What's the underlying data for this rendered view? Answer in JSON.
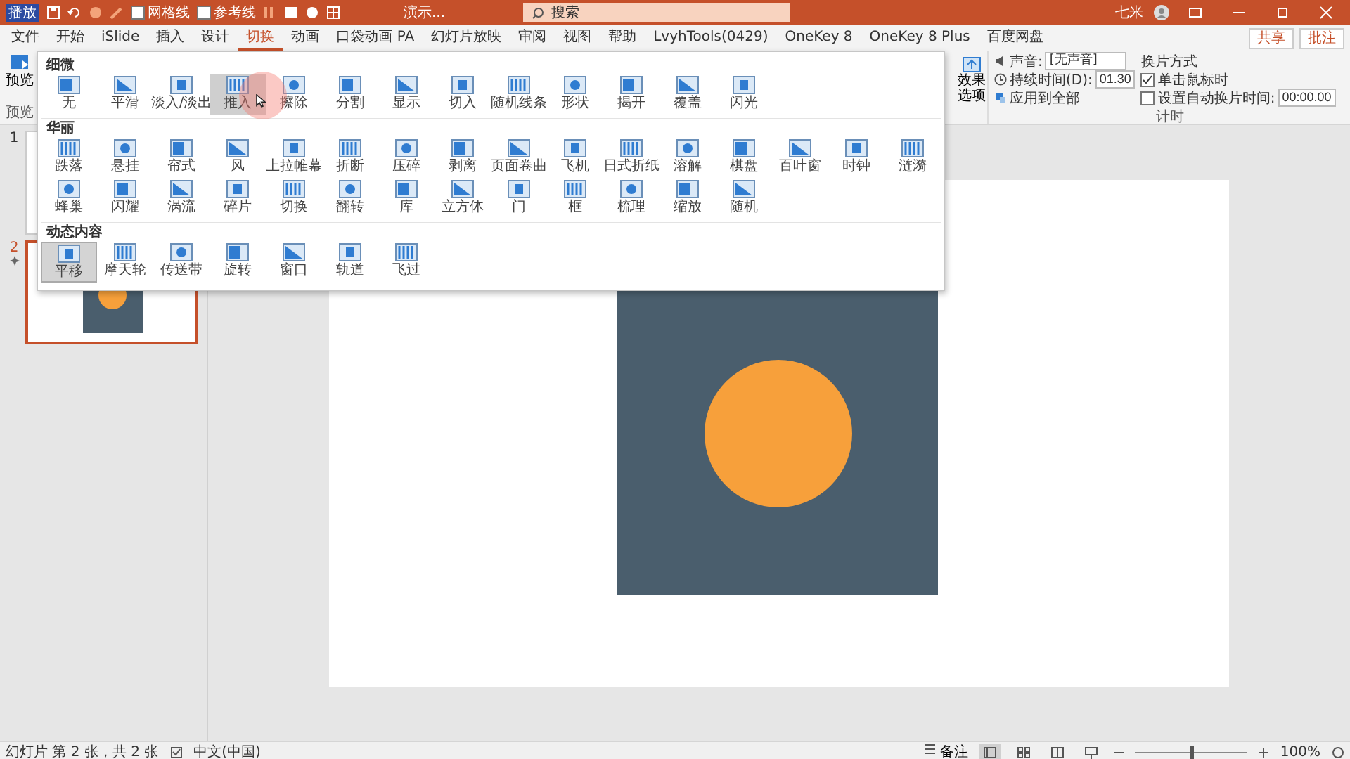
{
  "title_bar": {
    "badge": "播放",
    "checkboxes": [
      {
        "label": "网格线",
        "checked": false
      },
      {
        "label": "参考线",
        "checked": false
      }
    ],
    "document_title": "演示...",
    "search": {
      "placeholder": "搜索"
    },
    "user": "七米"
  },
  "tabs": [
    {
      "label": "文件",
      "selected": false
    },
    {
      "label": "开始",
      "selected": false
    },
    {
      "label": "iSlide",
      "selected": false
    },
    {
      "label": "插入",
      "selected": false
    },
    {
      "label": "设计",
      "selected": false
    },
    {
      "label": "切换",
      "selected": true
    },
    {
      "label": "动画",
      "selected": false
    },
    {
      "label": "口袋动画 PA",
      "selected": false
    },
    {
      "label": "幻灯片放映",
      "selected": false
    },
    {
      "label": "审阅",
      "selected": false
    },
    {
      "label": "视图",
      "selected": false
    },
    {
      "label": "帮助",
      "selected": false
    },
    {
      "label": "LvyhTools(0429)",
      "selected": false
    },
    {
      "label": "OneKey 8",
      "selected": false
    },
    {
      "label": "OneKey 8 Plus",
      "selected": false
    },
    {
      "label": "百度网盘",
      "selected": false
    }
  ],
  "share_buttons": [
    "共享",
    "批注"
  ],
  "ribbon": {
    "preview": {
      "label": "预览",
      "group": "预览"
    },
    "effect_options": "效果选项",
    "timing": {
      "sound_label": "声音:",
      "sound_value": "[无声音]",
      "duration_label": "持续时间(D):",
      "duration_value": "01.30",
      "apply_all": "应用到全部",
      "advance_heading": "换片方式",
      "on_click": {
        "label": "单击鼠标时",
        "checked": true
      },
      "after": {
        "label": "设置自动换片时间:",
        "checked": false,
        "value": "00:00.00"
      },
      "group": "计时"
    }
  },
  "gallery": {
    "sections": [
      {
        "title": "细微",
        "items": [
          {
            "label": "无",
            "selected": false,
            "hover": false
          },
          {
            "label": "平滑",
            "selected": false,
            "hover": false
          },
          {
            "label": "淡入/淡出",
            "selected": false,
            "hover": false
          },
          {
            "label": "推入",
            "selected": false,
            "hover": true
          },
          {
            "label": "擦除",
            "selected": false,
            "hover": false
          },
          {
            "label": "分割",
            "selected": false,
            "hover": false
          },
          {
            "label": "显示",
            "selected": false,
            "hover": false
          },
          {
            "label": "切入",
            "selected": false,
            "hover": false
          },
          {
            "label": "随机线条",
            "selected": false,
            "hover": false
          },
          {
            "label": "形状",
            "selected": false,
            "hover": false
          },
          {
            "label": "揭开",
            "selected": false,
            "hover": false
          },
          {
            "label": "覆盖",
            "selected": false,
            "hover": false
          },
          {
            "label": "闪光",
            "selected": false,
            "hover": false
          }
        ]
      },
      {
        "title": "华丽",
        "items": [
          {
            "label": "跌落",
            "selected": false,
            "hover": false
          },
          {
            "label": "悬挂",
            "selected": false,
            "hover": false
          },
          {
            "label": "帘式",
            "selected": false,
            "hover": false
          },
          {
            "label": "风",
            "selected": false,
            "hover": false
          },
          {
            "label": "上拉帷幕",
            "selected": false,
            "hover": false
          },
          {
            "label": "折断",
            "selected": false,
            "hover": false
          },
          {
            "label": "压碎",
            "selected": false,
            "hover": false
          },
          {
            "label": "剥离",
            "selected": false,
            "hover": false
          },
          {
            "label": "页面卷曲",
            "selected": false,
            "hover": false
          },
          {
            "label": "飞机",
            "selected": false,
            "hover": false
          },
          {
            "label": "日式折纸",
            "selected": false,
            "hover": false
          },
          {
            "label": "溶解",
            "selected": false,
            "hover": false
          },
          {
            "label": "棋盘",
            "selected": false,
            "hover": false
          },
          {
            "label": "百叶窗",
            "selected": false,
            "hover": false
          },
          {
            "label": "时钟",
            "selected": false,
            "hover": false
          },
          {
            "label": "涟漪",
            "selected": false,
            "hover": false
          },
          {
            "label": "蜂巢",
            "selected": false,
            "hover": false
          },
          {
            "label": "闪耀",
            "selected": false,
            "hover": false
          },
          {
            "label": "涡流",
            "selected": false,
            "hover": false
          },
          {
            "label": "碎片",
            "selected": false,
            "hover": false
          },
          {
            "label": "切换",
            "selected": false,
            "hover": false
          },
          {
            "label": "翻转",
            "selected": false,
            "hover": false
          },
          {
            "label": "库",
            "selected": false,
            "hover": false
          },
          {
            "label": "立方体",
            "selected": false,
            "hover": false
          },
          {
            "label": "门",
            "selected": false,
            "hover": false
          },
          {
            "label": "框",
            "selected": false,
            "hover": false
          },
          {
            "label": "梳理",
            "selected": false,
            "hover": false
          },
          {
            "label": "缩放",
            "selected": false,
            "hover": false
          },
          {
            "label": "随机",
            "selected": false,
            "hover": false
          }
        ]
      },
      {
        "title": "动态内容",
        "items": [
          {
            "label": "平移",
            "selected": true,
            "hover": false
          },
          {
            "label": "摩天轮",
            "selected": false,
            "hover": false
          },
          {
            "label": "传送带",
            "selected": false,
            "hover": false
          },
          {
            "label": "旋转",
            "selected": false,
            "hover": false
          },
          {
            "label": "窗口",
            "selected": false,
            "hover": false
          },
          {
            "label": "轨道",
            "selected": false,
            "hover": false
          },
          {
            "label": "飞过",
            "selected": false,
            "hover": false
          }
        ]
      }
    ]
  },
  "slides": [
    {
      "number": "1",
      "selected": false,
      "has_transition": false,
      "kind": "blank"
    },
    {
      "number": "2",
      "selected": true,
      "has_transition": true,
      "kind": "shapes"
    }
  ],
  "status_bar": {
    "slide_info": "幻灯片 第 2 张，共 2 张",
    "language": "中文(中国)",
    "notes": "备注",
    "views": [
      {
        "kind": "normal",
        "selected": true
      },
      {
        "kind": "sorter",
        "selected": false
      },
      {
        "kind": "reading",
        "selected": false
      },
      {
        "kind": "show",
        "selected": false
      }
    ],
    "zoom": {
      "level": 0.5,
      "reading": "100%"
    }
  }
}
